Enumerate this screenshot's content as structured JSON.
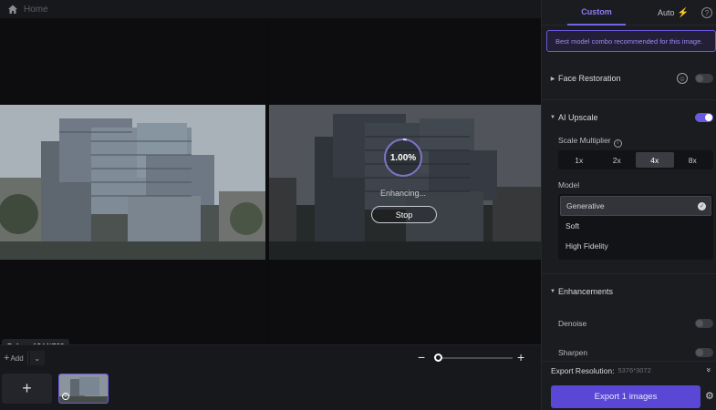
{
  "topbar": {
    "home_label": "Home"
  },
  "canvas": {
    "progress_text": "1.00%",
    "progress_fraction": 0.01,
    "status_text": "Enhancing...",
    "stop_label": "Stop",
    "before_badge": "Before: 1344*768"
  },
  "bottom": {
    "add_label": "Add",
    "add_icon": "+",
    "chevron_icon": "⌄",
    "zoom_minus": "−",
    "zoom_plus": "+",
    "zoom_level_fraction": 0.0,
    "add_tile_icon": "+",
    "thumb_info_icon": "i"
  },
  "panel": {
    "tab_custom": "Custom",
    "tab_auto": "Auto",
    "auto_bolt": "⚡",
    "help_icon": "?",
    "recommend_text": "Best model combo recommended for this image.",
    "face_restoration": {
      "label": "Face Restoration",
      "enabled": false,
      "icon": "☺"
    },
    "ai_upscale": {
      "label": "AI Upscale",
      "enabled": true
    },
    "scale_label": "Scale Multiplier",
    "scale_info_icon": "i",
    "scale_options": [
      "1x",
      "2x",
      "4x",
      "8x"
    ],
    "scale_selected": "4x",
    "model_label": "Model",
    "models": [
      "Generative",
      "Soft",
      "High Fidelity"
    ],
    "model_selected": "Generative",
    "check_icon": "✓",
    "enhancements_label": "Enhancements",
    "denoise": {
      "label": "Denoise",
      "enabled": false
    },
    "sharpen": {
      "label": "Sharpen",
      "enabled": false
    },
    "export_res_label": "Export Resolution:",
    "export_res_value": "5376*3072",
    "export_res_chevron": "»",
    "export_label": "Export 1 images",
    "settings_icon": "⚙"
  },
  "colors": {
    "accent": "#6a5ae0",
    "export_button": "#5b47d6",
    "bolt": "#e9c23a"
  }
}
